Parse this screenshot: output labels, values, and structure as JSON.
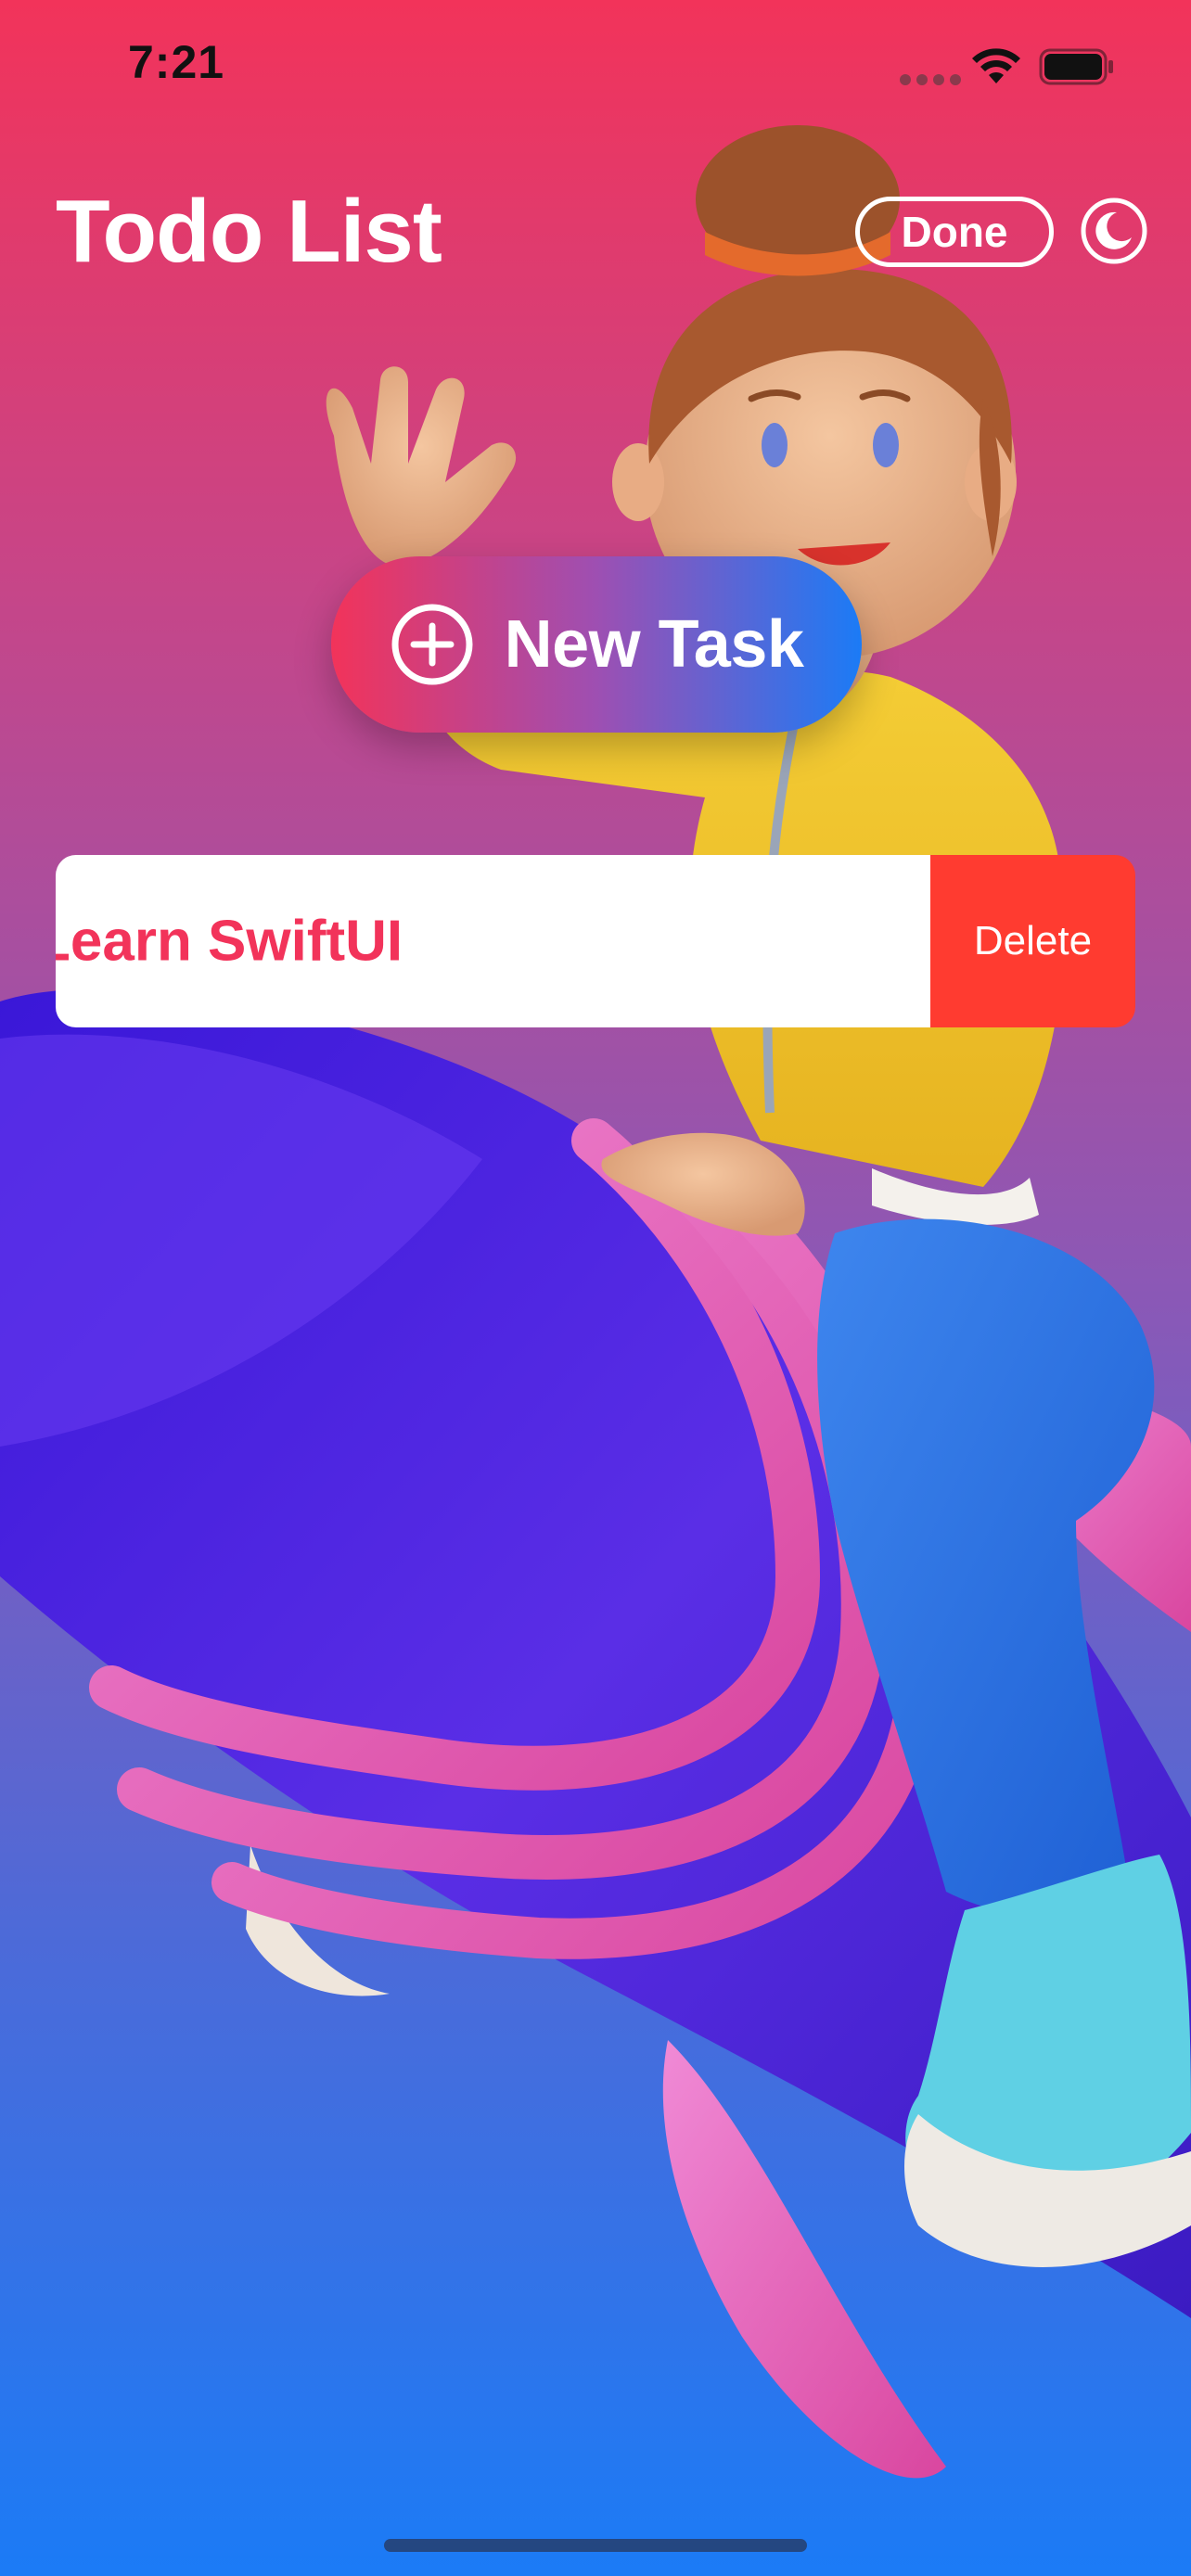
{
  "status_bar": {
    "time": "7:21",
    "wifi_icon": "wifi-icon",
    "battery_icon": "battery-full-icon"
  },
  "header": {
    "title": "Todo List",
    "done_label": "Done",
    "theme_toggle_icon": "moon-icon"
  },
  "new_task": {
    "label": "New Task",
    "icon": "plus-circle-icon"
  },
  "tasks": [
    {
      "title": "Learn SwiftUI",
      "delete_label": "Delete"
    }
  ],
  "colors": {
    "gradient_top": "#f2335a",
    "gradient_bottom": "#1b7bf6",
    "task_text": "#f2335a",
    "delete_red": "#ff3b30"
  }
}
